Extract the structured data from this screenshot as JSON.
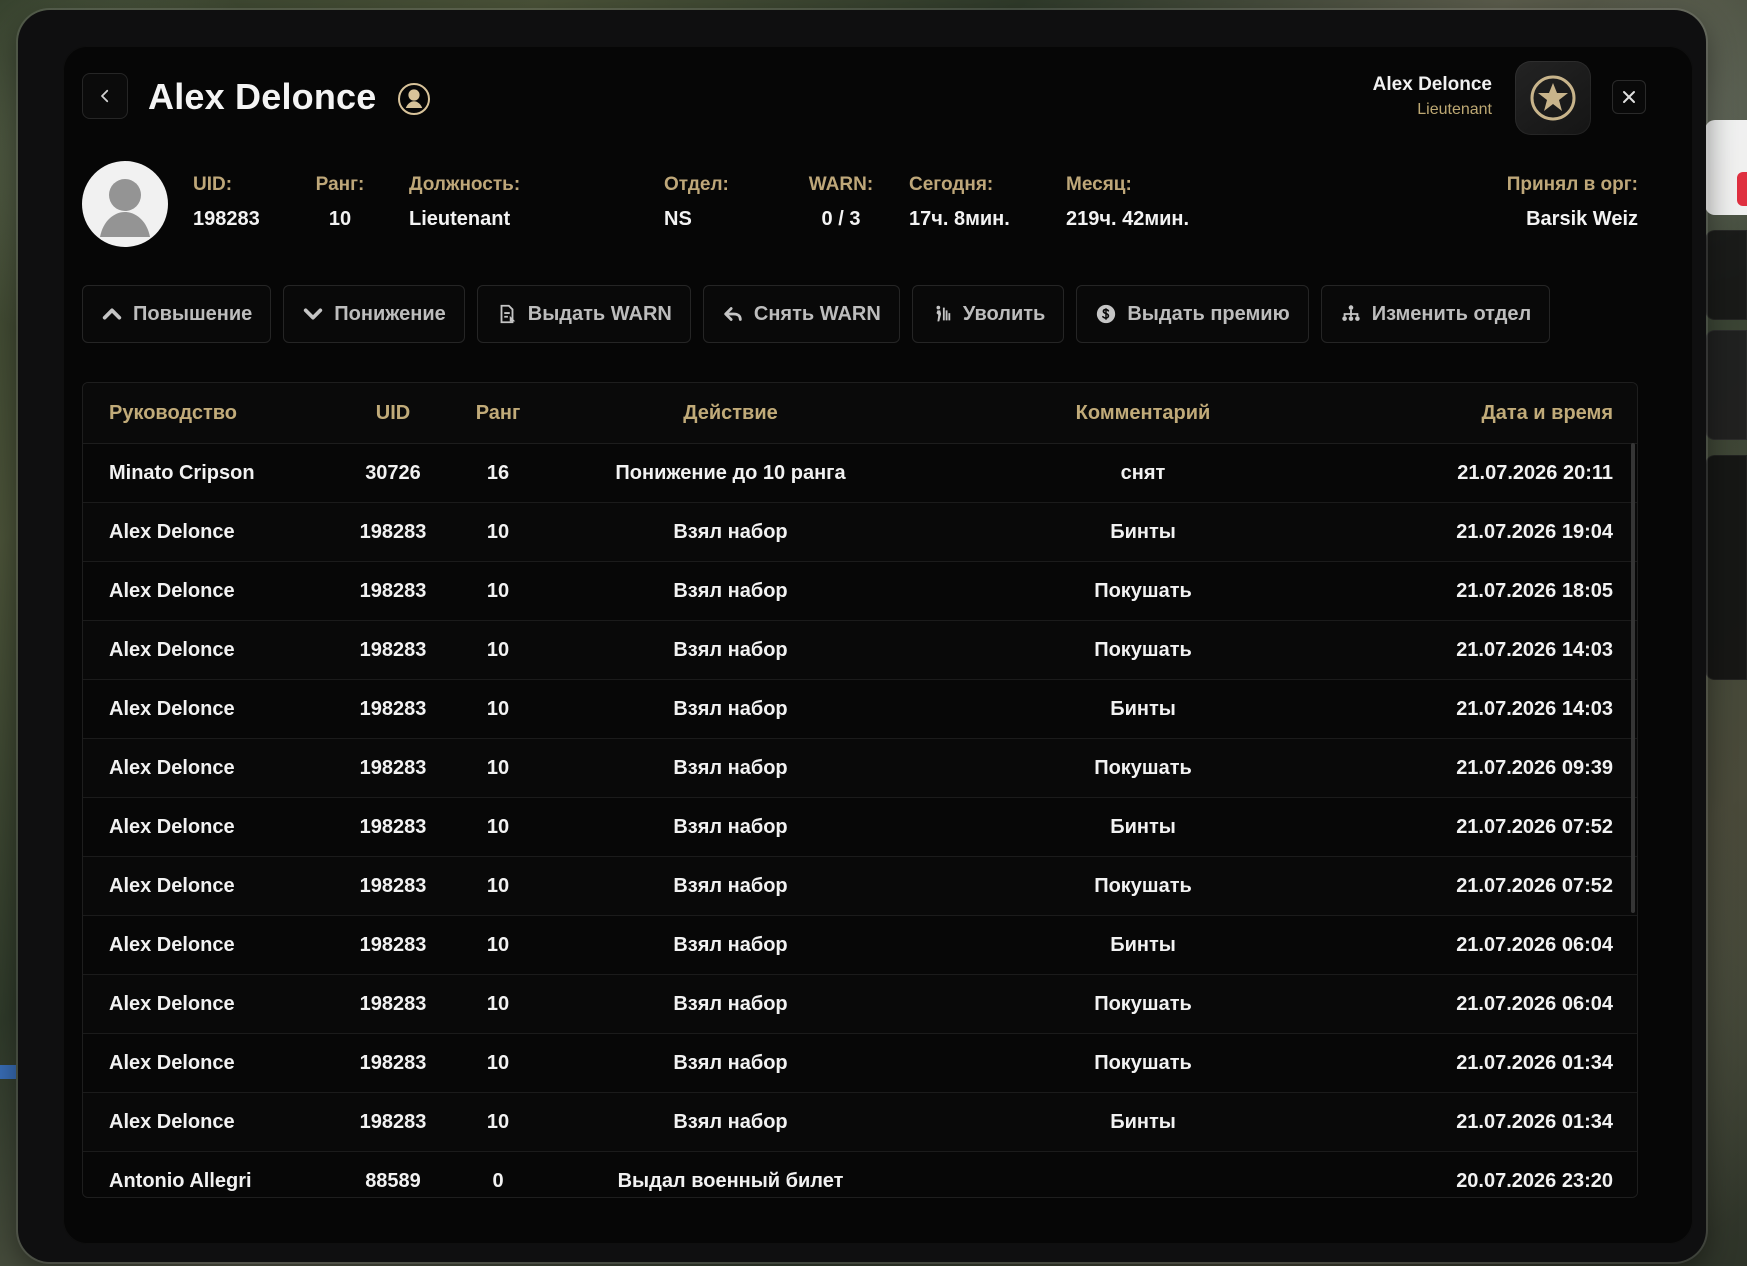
{
  "header": {
    "title": "Alex Delonce",
    "user_name": "Alex Delonce",
    "user_rank": "Lieutenant"
  },
  "stats": [
    {
      "label": "UID:",
      "value": "198283"
    },
    {
      "label": "Ранг:",
      "value": "10"
    },
    {
      "label": "Должность:",
      "value": "Lieutenant"
    },
    {
      "label": "Отдел:",
      "value": "NS"
    },
    {
      "label": "WARN:",
      "value": "0 / 3"
    },
    {
      "label": "Сегодня:",
      "value": "17ч. 8мин."
    },
    {
      "label": "Месяц:",
      "value": "219ч. 42мин."
    },
    {
      "label": "Принял в орг:",
      "value": "Barsik Weiz"
    }
  ],
  "actions": [
    {
      "label": "Повышение",
      "icon": "chevron-up-icon"
    },
    {
      "label": "Понижение",
      "icon": "chevron-down-icon"
    },
    {
      "label": "Выдать WARN",
      "icon": "warn-doc-icon"
    },
    {
      "label": "Снять WARN",
      "icon": "undo-icon"
    },
    {
      "label": "Уволить",
      "icon": "dismiss-icon"
    },
    {
      "label": "Выдать премию",
      "icon": "money-icon"
    },
    {
      "label": "Изменить отдел",
      "icon": "hierarchy-icon"
    }
  ],
  "table": {
    "headers": [
      "Руководство",
      "UID",
      "Ранг",
      "Действие",
      "Комментарий",
      "Дата и время"
    ],
    "rows": [
      [
        "Minato Cripson",
        "30726",
        "16",
        "Понижение до 10 ранга",
        "снят",
        "21.07.2026 20:11"
      ],
      [
        "Alex Delonce",
        "198283",
        "10",
        "Взял набор",
        "Бинты",
        "21.07.2026 19:04"
      ],
      [
        "Alex Delonce",
        "198283",
        "10",
        "Взял набор",
        "Покушать",
        "21.07.2026 18:05"
      ],
      [
        "Alex Delonce",
        "198283",
        "10",
        "Взял набор",
        "Покушать",
        "21.07.2026 14:03"
      ],
      [
        "Alex Delonce",
        "198283",
        "10",
        "Взял набор",
        "Бинты",
        "21.07.2026 14:03"
      ],
      [
        "Alex Delonce",
        "198283",
        "10",
        "Взял набор",
        "Покушать",
        "21.07.2026 09:39"
      ],
      [
        "Alex Delonce",
        "198283",
        "10",
        "Взял набор",
        "Бинты",
        "21.07.2026 07:52"
      ],
      [
        "Alex Delonce",
        "198283",
        "10",
        "Взял набор",
        "Покушать",
        "21.07.2026 07:52"
      ],
      [
        "Alex Delonce",
        "198283",
        "10",
        "Взял набор",
        "Бинты",
        "21.07.2026 06:04"
      ],
      [
        "Alex Delonce",
        "198283",
        "10",
        "Взял набор",
        "Покушать",
        "21.07.2026 06:04"
      ],
      [
        "Alex Delonce",
        "198283",
        "10",
        "Взял набор",
        "Покушать",
        "21.07.2026 01:34"
      ],
      [
        "Alex Delonce",
        "198283",
        "10",
        "Взял набор",
        "Бинты",
        "21.07.2026 01:34"
      ],
      [
        "Antonio Allegri",
        "88589",
        "0",
        "Выдал военный билет",
        "",
        "20.07.2026 23:20"
      ]
    ]
  },
  "colors": {
    "accent": "#bea779",
    "panel": "#060606",
    "text": "#f2f2f2",
    "muted": "#bdbdbd"
  }
}
